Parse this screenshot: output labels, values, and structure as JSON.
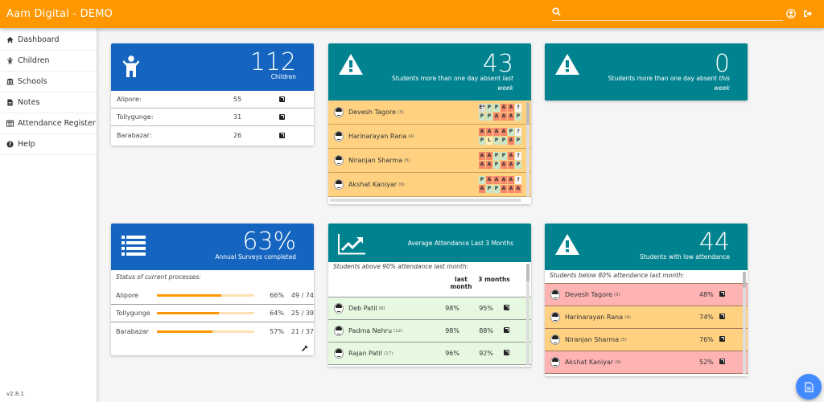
{
  "app": {
    "title": "Aam Digital - DEMO",
    "version": "v2.8.1",
    "search": {
      "placeholder": "",
      "value": ""
    },
    "toolbar_icons": [
      "search-icon",
      "user-account-icon",
      "logout-icon"
    ],
    "accent_color": "#ff9800"
  },
  "sidebar": {
    "items": [
      {
        "label": "Dashboard",
        "icon": "home-icon"
      },
      {
        "label": "Children",
        "icon": "child-icon"
      },
      {
        "label": "Schools",
        "icon": "university-icon"
      },
      {
        "label": "Notes",
        "icon": "file-text-icon"
      },
      {
        "label": "Attendance Register",
        "icon": "table-icon"
      },
      {
        "label": "Help",
        "icon": "question-circle-icon"
      }
    ]
  },
  "children_card": {
    "count": "112",
    "label": "Children",
    "rows": [
      {
        "label": "Alipore:",
        "value": "55"
      },
      {
        "label": "Tollygunge:",
        "value": "31"
      },
      {
        "label": "Barabazar:",
        "value": "26"
      }
    ]
  },
  "absent_last_week": {
    "count": "43",
    "label_main": "Students more than one day absent ",
    "label_em": "last week",
    "students": [
      {
        "name": "Devesh Tagore",
        "id": "(3)",
        "week1": [
          "E*",
          "P",
          "P",
          "A",
          "A",
          "?"
        ],
        "week2": [
          "P",
          "P",
          "A",
          "A",
          "A",
          "P"
        ]
      },
      {
        "name": "Harinarayan Rana",
        "id": "(4)",
        "week1": [
          "A",
          "A",
          "A",
          "A",
          "P",
          "?"
        ],
        "week2": [
          "P",
          "L",
          "P",
          "P",
          "A",
          "P"
        ]
      },
      {
        "name": "Niranjan Sharma",
        "id": "(5)",
        "week1": [
          "A",
          "A",
          "P",
          "P",
          "A",
          "?"
        ],
        "week2": [
          "A",
          "A",
          "P",
          "A",
          "A",
          "P"
        ]
      },
      {
        "name": "Akshat Kaniyar",
        "id": "(9)",
        "week1": [
          "P",
          "A",
          "A",
          "A",
          "A",
          "?"
        ],
        "week2": [
          "A",
          "P",
          "P",
          "A",
          "A",
          "A"
        ]
      }
    ]
  },
  "absent_this_week": {
    "count": "0",
    "label_main": "Students more than one day absent ",
    "label_em": "this week"
  },
  "surveys_card": {
    "percent": "63%",
    "label": "Annual Surveys completed",
    "subtitle": "Status of current processes:",
    "rows": [
      {
        "label": "Alipore",
        "progress": 0.66,
        "percent": "66%",
        "count": "49 / 74"
      },
      {
        "label": "Tollygunge",
        "progress": 0.64,
        "percent": "64%",
        "count": "25 / 39"
      },
      {
        "label": "Barabazar",
        "progress": 0.57,
        "percent": "57%",
        "count": "21 / 37"
      }
    ]
  },
  "avg_attendance": {
    "title": "Average Attendance Last 3 Months",
    "subtitle": "Students above 90% attendance last month:",
    "col_last_month": "last month",
    "col_3_months": "3 months",
    "students": [
      {
        "name": "Deb Patil",
        "id": "(8)",
        "last_month": "98%",
        "three_months": "95%"
      },
      {
        "name": "Padma Nehru",
        "id": "(12)",
        "last_month": "98%",
        "three_months": "88%"
      },
      {
        "name": "Rajan Patil",
        "id": "(17)",
        "last_month": "96%",
        "three_months": "92%"
      }
    ]
  },
  "low_attendance": {
    "count": "44",
    "label": "Students with low attendance",
    "subtitle": "Students below 80% attendance last month:",
    "students": [
      {
        "name": "Devesh Tagore",
        "id": "(3)",
        "value": "48%",
        "level": "pink"
      },
      {
        "name": "Harinarayan Rana",
        "id": "(4)",
        "value": "74%",
        "level": "orange"
      },
      {
        "name": "Niranjan Sharma",
        "id": "(5)",
        "value": "76%",
        "level": "orange"
      },
      {
        "name": "Akshat Kaniyar",
        "id": "(9)",
        "value": "52%",
        "level": "pink"
      }
    ]
  }
}
